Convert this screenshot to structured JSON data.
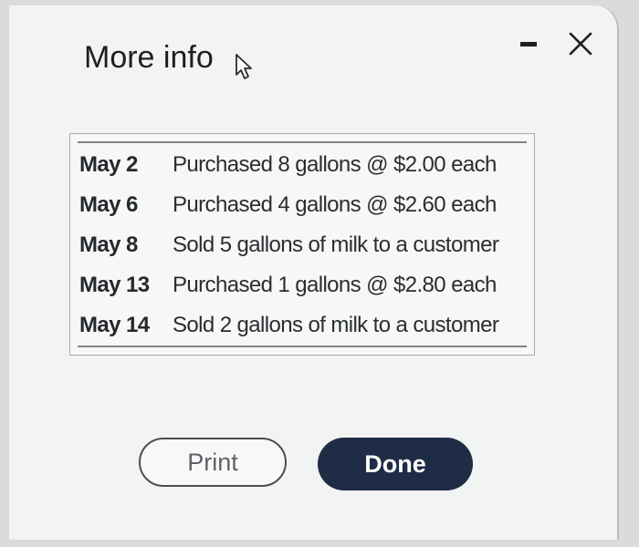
{
  "dialog": {
    "title": "More info"
  },
  "window_controls": {
    "minimize_icon": "minimize-icon",
    "close_icon": "close-icon"
  },
  "table": {
    "rows": [
      {
        "date": "May 2",
        "description": "Purchased 8 gallons @ $2.00 each"
      },
      {
        "date": "May 6",
        "description": "Purchased 4 gallons @ $2.60 each"
      },
      {
        "date": "May 8",
        "description": "Sold 5 gallons of milk to a customer"
      },
      {
        "date": "May 13",
        "description": "Purchased 1 gallons @ $2.80 each"
      },
      {
        "date": "May 14",
        "description": "Sold 2 gallons of milk to a customer"
      }
    ]
  },
  "buttons": {
    "print_label": "Print",
    "done_label": "Done"
  },
  "colors": {
    "done_button_bg": "#1f2c45",
    "dialog_bg": "#f2f3f3"
  }
}
